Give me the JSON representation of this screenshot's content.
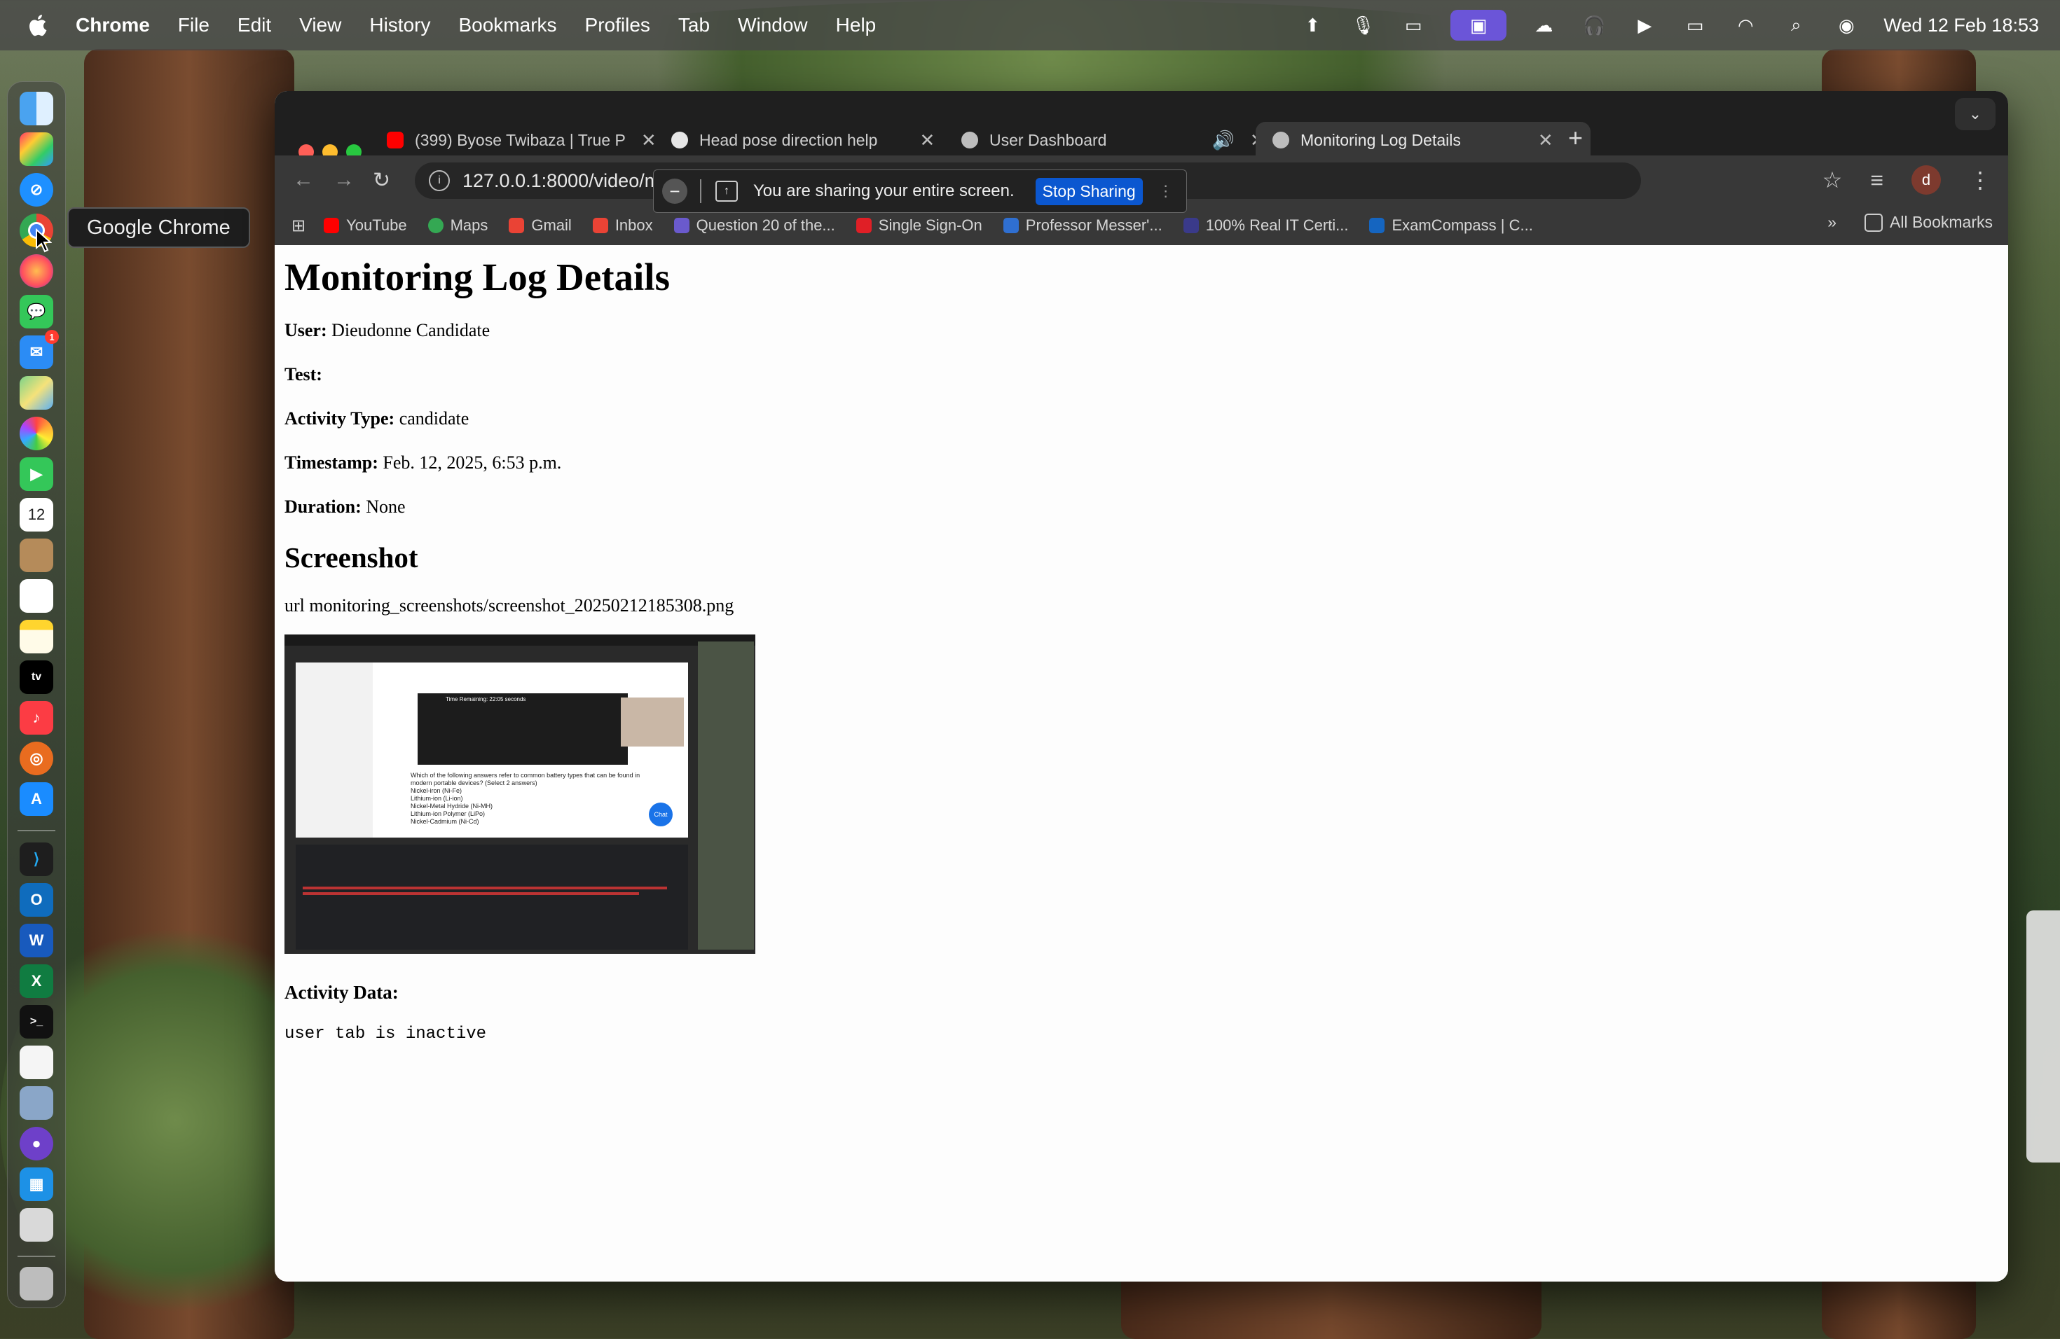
{
  "menubar": {
    "app_name": "Chrome",
    "menus": [
      "File",
      "Edit",
      "View",
      "History",
      "Bookmarks",
      "Profiles",
      "Tab",
      "Window",
      "Help"
    ],
    "clock": "Wed 12 Feb  18:53"
  },
  "dock": {
    "tooltip": "Google Chrome",
    "mail_badge": "1",
    "calendar_day": "12",
    "tv_label": "tv"
  },
  "tabs": [
    {
      "title": "(399) Byose Twibaza | True P",
      "icon": "youtube-icon",
      "color": "#ff0000",
      "active": false,
      "muted": false
    },
    {
      "title": "Head pose direction help",
      "icon": "openai-icon",
      "color": "#e6e6e6",
      "active": false,
      "muted": false
    },
    {
      "title": "User Dashboard",
      "icon": "globe-icon",
      "color": "#bdbdbd",
      "active": false,
      "muted": true
    },
    {
      "title": "Monitoring Log Details",
      "icon": "globe-icon",
      "color": "#bdbdbd",
      "active": true,
      "muted": false
    }
  ],
  "omnibox": {
    "url": "127.0.0.1:8000/video/mo"
  },
  "sharing": {
    "message": "You are sharing your entire screen.",
    "stop_label": "Stop Sharing"
  },
  "profile_initial": "d",
  "bookmarks": [
    {
      "label": "YouTube",
      "color": "#ff0000"
    },
    {
      "label": "Maps",
      "color": "#34a853"
    },
    {
      "label": "Gmail",
      "color": "#ea4335"
    },
    {
      "label": "Inbox",
      "color": "#ea4335"
    },
    {
      "label": "Question 20 of the...",
      "color": "#6a5acd"
    },
    {
      "label": "Single Sign-On",
      "color": "#e01f26"
    },
    {
      "label": "Professor Messer'...",
      "color": "#2f6fd1"
    },
    {
      "label": "100% Real IT Certi...",
      "color": "#3a3a8a"
    },
    {
      "label": "ExamCompass | C...",
      "color": "#1565c0"
    }
  ],
  "all_bookmarks_label": "All Bookmarks",
  "page": {
    "title": "Monitoring Log Details",
    "fields": [
      {
        "label": "User:",
        "value": "Dieudonne Candidate"
      },
      {
        "label": "Test:",
        "value": ""
      },
      {
        "label": "Activity Type:",
        "value": "candidate"
      },
      {
        "label": "Timestamp:",
        "value": "Feb. 12, 2025, 6:53 p.m."
      },
      {
        "label": "Duration:",
        "value": "None"
      }
    ],
    "screenshot_heading": "Screenshot",
    "screenshot_url": "url monitoring_screenshots/screenshot_20250212185308.png",
    "thumb": {
      "question": "Which of the following answers refer to common battery types that can be found in modern portable devices? (Select 2 answers)",
      "options": [
        "Nickel-iron (Ni-Fe)",
        "Lithium-ion (Li-ion)",
        "Nickel-Metal Hydride (Ni-MH)",
        "Lithium-ion Polymer (LiPo)",
        "Nickel-Cadmium (Ni-Cd)"
      ],
      "chat": "Chat",
      "timer": "Time Remaining: 22:05 seconds"
    },
    "activity_label": "Activity Data:",
    "activity_value": "user tab is inactive"
  }
}
